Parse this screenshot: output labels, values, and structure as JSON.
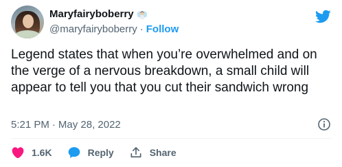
{
  "author": {
    "display_name": "Maryfairyboberry",
    "handle": "@maryfairyboberry",
    "separator": "·",
    "follow_label": "Follow",
    "avatar_icon": "profile-photo",
    "name_emoji": "fairy-emoji"
  },
  "tweet": {
    "text": "Legend states that when you’re overwhelmed and on the verge of a nervous breakdown, a small child will appear to tell you that you cut their sandwich wrong"
  },
  "meta": {
    "time": "5:21 PM",
    "separator": "·",
    "date": "May 28, 2022",
    "info_icon": "info-icon"
  },
  "actions": {
    "like_count": "1.6K",
    "reply_label": "Reply",
    "share_label": "Share"
  },
  "colors": {
    "brand": "#1d9bf0",
    "like": "#f91880",
    "muted_text": "#536471",
    "text": "#0f1419"
  }
}
